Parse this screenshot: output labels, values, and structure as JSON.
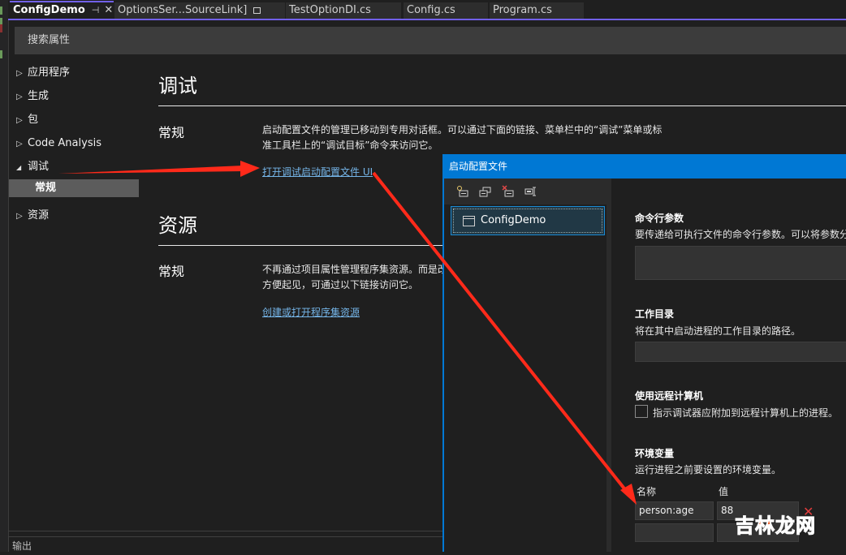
{
  "tabs": [
    {
      "label": "ConfigDemo",
      "active": true,
      "pin_icon": "pin-icon",
      "close_icon": "close-icon"
    },
    {
      "label": "OptionsSer...SourceLink]",
      "lock_icon": "lock-icon"
    },
    {
      "label": "TestOptionDI.cs"
    },
    {
      "label": "Config.cs"
    },
    {
      "label": "Program.cs"
    }
  ],
  "search": {
    "placeholder": "搜索属性"
  },
  "nav": {
    "items": [
      {
        "label": "应用程序",
        "expanded": false
      },
      {
        "label": "生成",
        "expanded": false
      },
      {
        "label": "包",
        "expanded": false
      },
      {
        "label": "Code Analysis",
        "expanded": false
      },
      {
        "label": "调试",
        "expanded": true
      },
      {
        "label": "资源",
        "expanded": false
      }
    ],
    "selected_child": "常规"
  },
  "sections": [
    {
      "title": "调试",
      "subsection": "常规",
      "desc_lines": [
        "启动配置文件的管理已移动到专用对话框。可以通过下面的链接、菜单栏中的“调试”菜单或标",
        "准工具栏上的“调试目标”命令来访问它。"
      ],
      "link": "打开调试启动配置文件 UI"
    },
    {
      "title": "资源",
      "subsection": "常规",
      "desc_lines": [
        "不再通过项目属性管理程序集资源。而是改",
        "方便起见，可通过以下链接访问它。"
      ],
      "link": "创建或打开程序集资源"
    }
  ],
  "output_panel": {
    "label": "输出"
  },
  "dialog": {
    "title": "启动配置文件",
    "toolbar": [
      "new-profile-icon",
      "copy-profile-icon",
      "delete-profile-icon",
      "rename-profile-icon"
    ],
    "profiles": [
      {
        "label": "ConfigDemo",
        "selected": true
      }
    ],
    "cmd_args": {
      "label": "命令行参数",
      "desc": "要传递给可执行文件的命令行参数。可以将参数分",
      "value": ""
    },
    "working_dir": {
      "label": "工作目录",
      "desc": "将在其中启动进程的工作目录的路径。",
      "value": ""
    },
    "remote": {
      "label": "使用远程计算机",
      "checkbox_label": "指示调试器应附加到远程计算机上的进程。",
      "checked": false
    },
    "env": {
      "label": "环境变量",
      "desc": "运行进程之前要设置的环境变量。",
      "col_name": "名称",
      "col_value": "值",
      "rows": [
        {
          "name": "person:age",
          "value": "88"
        },
        {
          "name": "",
          "value": ""
        }
      ]
    }
  },
  "watermark": {
    "part1": "吉林",
    "part2": "龙网"
  },
  "colors": {
    "accent": "#7160e8",
    "dialog_title": "#0078d4",
    "link": "#75b5e8",
    "arrow": "#ff2a1a"
  }
}
